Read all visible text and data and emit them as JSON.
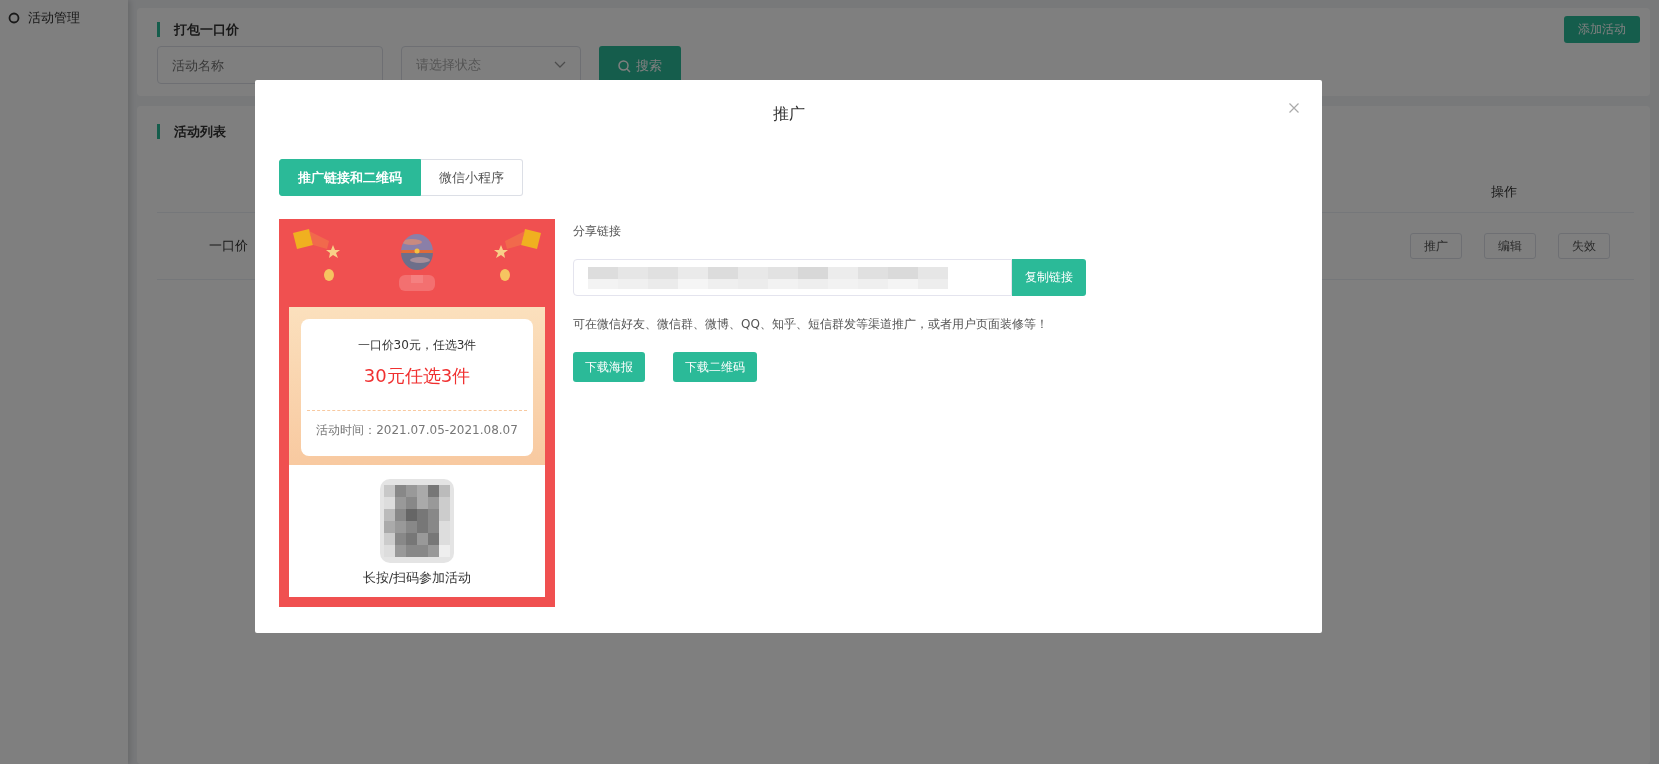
{
  "sidebar": {
    "items": [
      {
        "label": "活动管理"
      }
    ]
  },
  "filters": {
    "title": "打包一口价",
    "add_button": "添加活动",
    "name_placeholder": "活动名称",
    "status_placeholder": "请选择状态",
    "search_button": "搜索"
  },
  "list": {
    "title": "活动列表",
    "columns": [
      {
        "label": "操作"
      }
    ],
    "rows": [
      {
        "column_1": "一口价",
        "actions": [
          "推广",
          "编辑",
          "失效"
        ]
      }
    ]
  },
  "dialog": {
    "title": "推广",
    "tabs": [
      {
        "label": "推广链接和二维码",
        "selected": true
      },
      {
        "label": "微信小程序",
        "selected": false
      }
    ],
    "poster": {
      "subtitle": "一口价30元，任选3件",
      "headline": "30元任选3件",
      "period": "活动时间：2021.07.05-2021.08.07",
      "caption": "长按/扫码参加活动"
    },
    "share": {
      "label": "分享链接",
      "copy_button": "复制链接",
      "hint": "可在微信好友、微信群、微博、QQ、知乎、短信群发等渠道推广，或者用户页面装修等！",
      "buttons": [
        "下载海报",
        "下载二维码"
      ]
    }
  }
}
